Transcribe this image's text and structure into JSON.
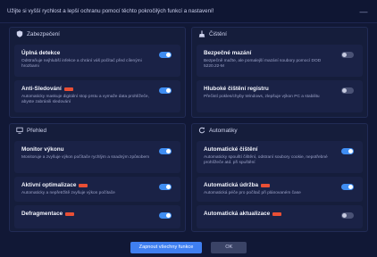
{
  "header": {
    "title": "Užijte si vyšší rychlost a lepší ochranu pomocí těchto pokročilých funkcí a nastavení!",
    "close": "—"
  },
  "sections": {
    "security": {
      "title": "Zabezpečení",
      "icon": "shield-icon"
    },
    "cleaning": {
      "title": "Čištění",
      "icon": "broom-icon"
    },
    "overview": {
      "title": "Přehled",
      "icon": "monitor-icon"
    },
    "automation": {
      "title": "Automatiky",
      "icon": "refresh-icon"
    }
  },
  "cards": {
    "full_detection": {
      "label": "Úplná detekce",
      "desc": "Odstraňuje nejhlubší infekce a chrání váš počítač před cílenými hrozbami",
      "enabled": true
    },
    "anti_tracking": {
      "label": "Anti-Sledování",
      "desc": "Automaticky maskuje digitální stop prstu a vymaže data prohlížeče, abyste zabránili sledování",
      "enabled": true
    },
    "secure_delete": {
      "label": "Bezpečné mazání",
      "desc": "Bezpečně mažte, ale pomalejší mazání soubory pomocí DOD 5220.22-M",
      "enabled": false
    },
    "deep_registry": {
      "label": "Hluboké čištění registru",
      "desc": "Přečistí pokles/chyby Windows, zlepšuje výkon PC a stabilitu",
      "enabled": false
    },
    "performance_monitor": {
      "label": "Monitor výkonu",
      "desc": "Monitoruje a zvyšuje výkon počítače rychlým a snadným způsobem",
      "enabled": true
    },
    "active_optimization": {
      "label": "Aktivní optimalizace",
      "desc": "Automaticky a nepřetržitě zvyšuje výkon počítače",
      "enabled": true
    },
    "defrag": {
      "label": "Defragmentace",
      "desc": "",
      "enabled": true
    },
    "auto_cleaning": {
      "label": "Automatické čištění",
      "desc": "Automaticky spouští čištění, odstraní soubory cookie, nepotřebné prohlížeče atd. při spuštění",
      "enabled": true
    },
    "auto_maintenance": {
      "label": "Automatická údržba",
      "desc": "Automatická péče pro počítač při plánovaném čase",
      "enabled": true
    },
    "auto_update": {
      "label": "Automatická aktualizace",
      "desc": "",
      "enabled": false
    }
  },
  "footer": {
    "enable_all": "Zapnout všechny funkce",
    "ok": "OK"
  }
}
